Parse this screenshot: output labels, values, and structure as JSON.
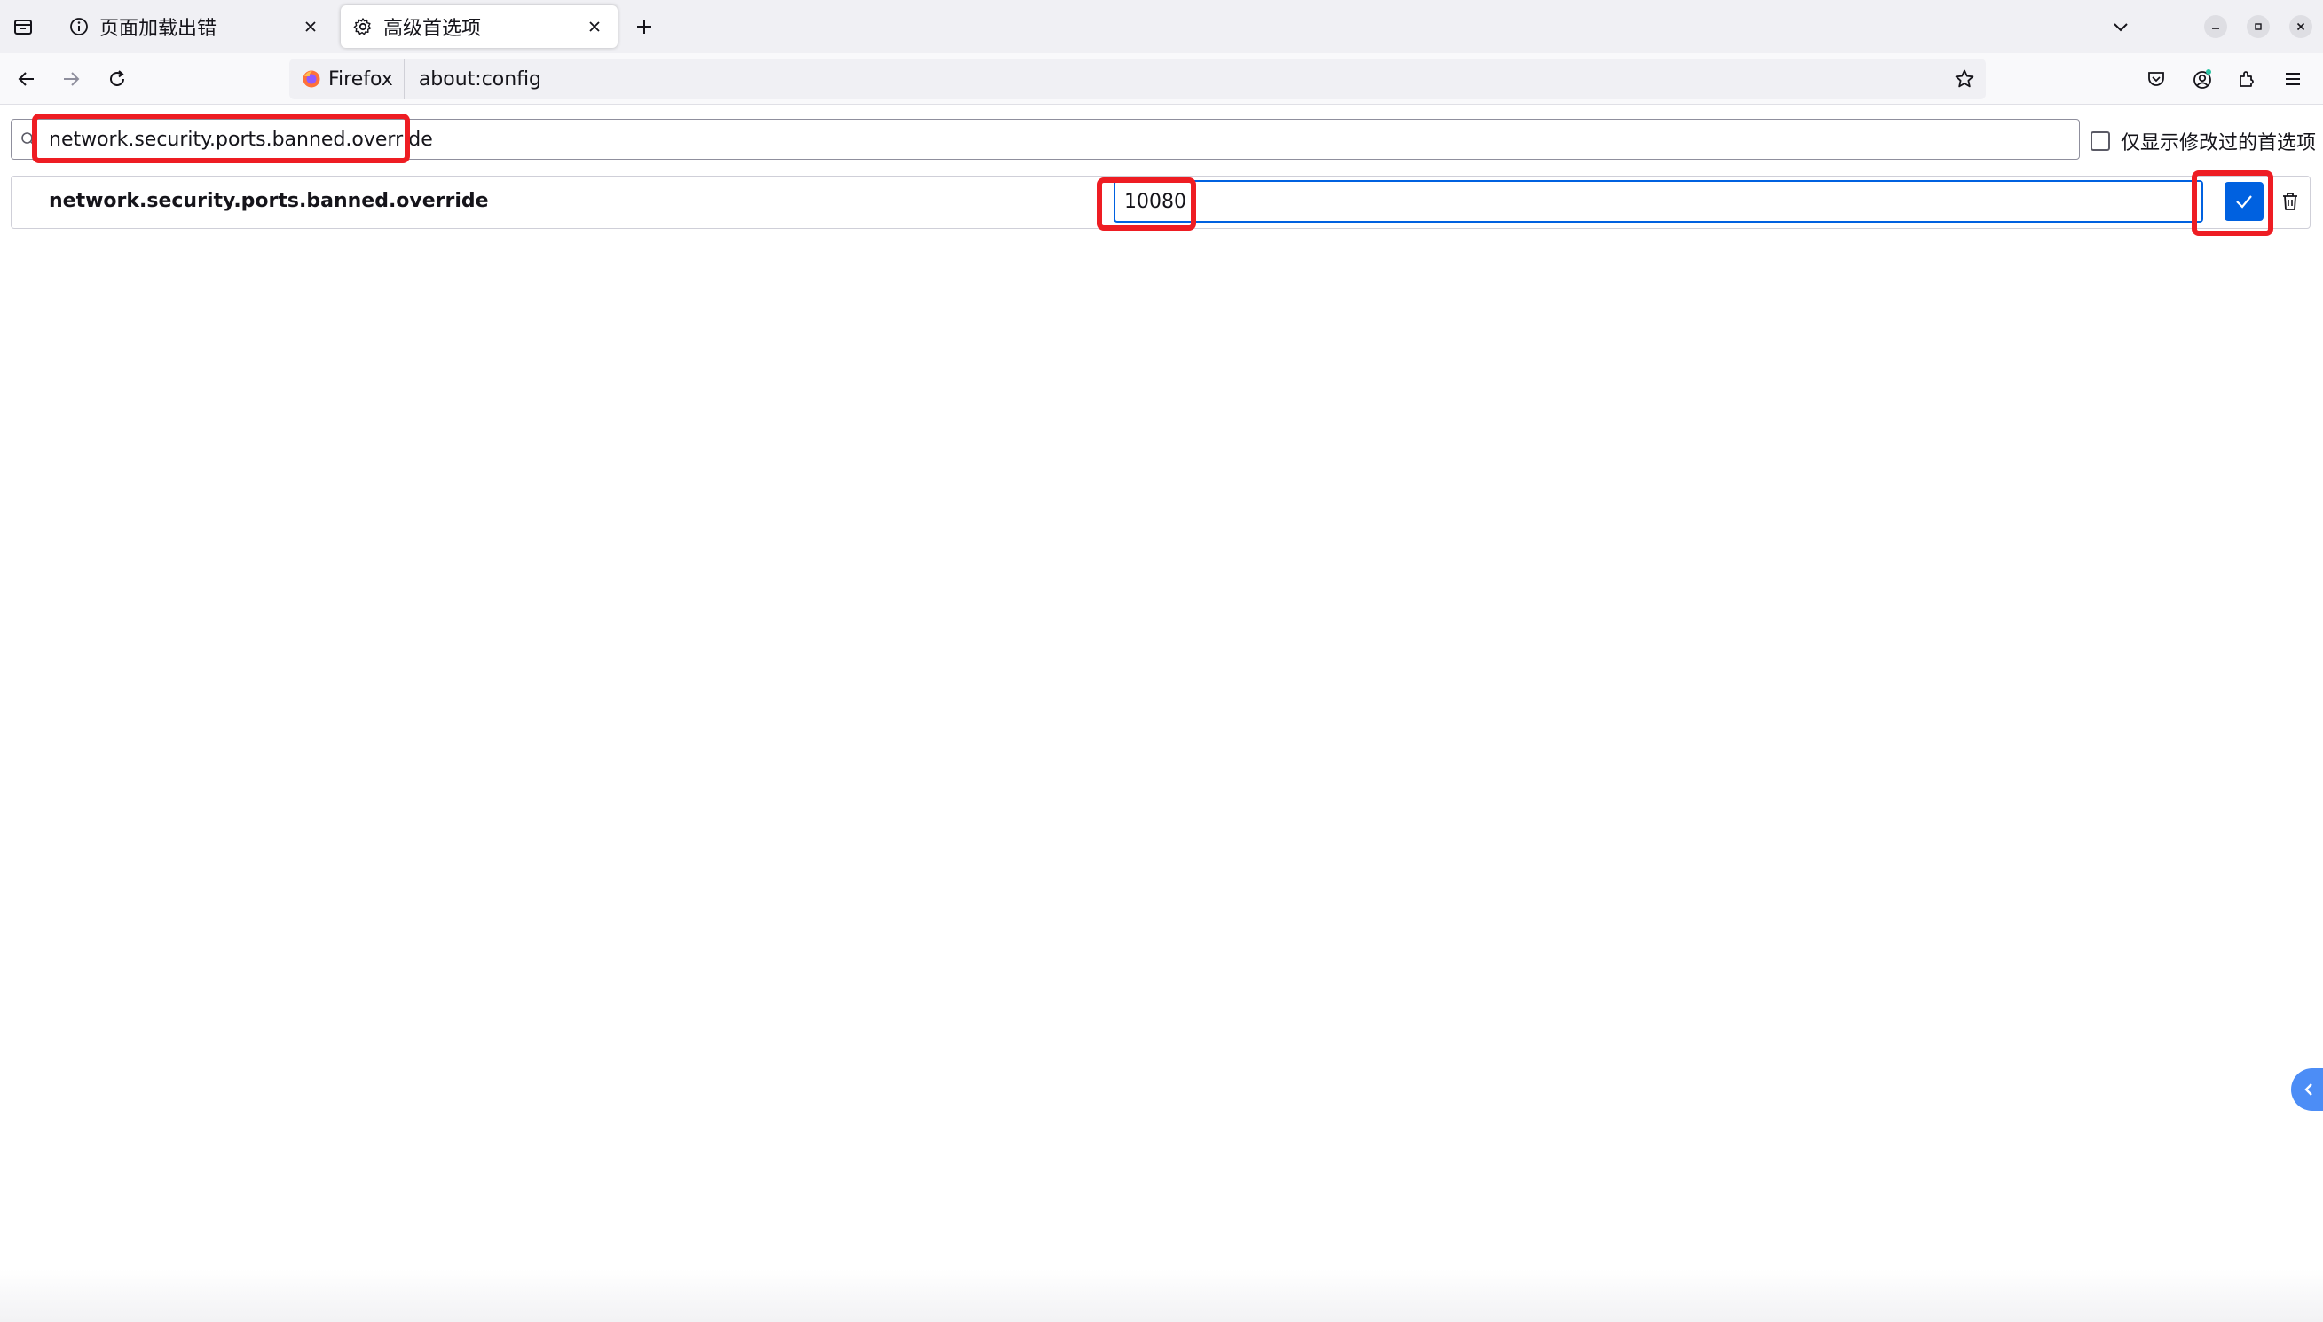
{
  "tabs": [
    {
      "label": "页面加载出错",
      "icon": "info-icon",
      "active": false
    },
    {
      "label": "高级首选项",
      "icon": "gear-icon",
      "active": true
    }
  ],
  "navbar": {
    "identity_label": "Firefox",
    "url": "about:config"
  },
  "config": {
    "search_value": "network.security.ports.banned.override",
    "modified_only_label": "仅显示修改过的首选项",
    "pref_name": "network.security.ports.banned.override",
    "pref_value": "10080"
  },
  "colors": {
    "accent": "#0061e0",
    "highlight": "#ee1d23",
    "tabstrip": "#f0f0f4"
  }
}
